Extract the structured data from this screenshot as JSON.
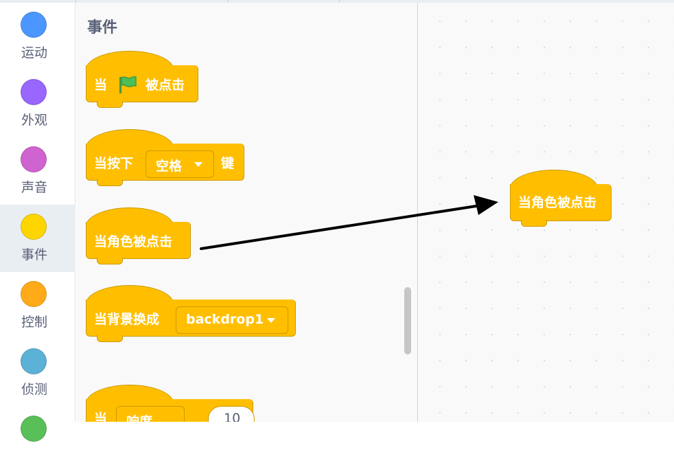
{
  "palette": {
    "title": "事件"
  },
  "categories": [
    {
      "label": "运动",
      "color": "#4c97ff"
    },
    {
      "label": "外观",
      "color": "#9966ff"
    },
    {
      "label": "声音",
      "color": "#cf63cf"
    },
    {
      "label": "事件",
      "color": "#ffd500",
      "active": true
    },
    {
      "label": "控制",
      "color": "#ffab19"
    },
    {
      "label": "侦测",
      "color": "#5cb1d6"
    },
    {
      "label": "",
      "color": "#59c059"
    }
  ],
  "blocks": {
    "flag_clicked": {
      "prefix": "当",
      "suffix": "被点击",
      "icon": "green-flag-icon"
    },
    "key_pressed": {
      "prefix": "当按下",
      "key_value": "空格",
      "suffix": "键"
    },
    "sprite_clicked": {
      "label": "当角色被点击"
    },
    "backdrop_switch": {
      "prefix": "当背景换成",
      "backdrop_value": "backdrop1"
    },
    "greater_than": {
      "prefix": "当",
      "sensor_value": "响度",
      "number_value": "10"
    }
  },
  "workspace": {
    "dropped_block": {
      "label": "当角色被点击"
    }
  }
}
